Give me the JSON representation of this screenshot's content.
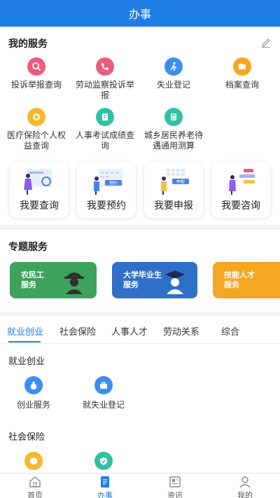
{
  "header": {
    "title": "办事"
  },
  "my_services": {
    "title": "我的服务",
    "items": [
      {
        "label": "投诉举报查询",
        "icon": "complaint-search-icon",
        "color": "#ef5a7a"
      },
      {
        "label": "劳动监察投诉举报",
        "icon": "phone-icon",
        "color": "#ef5a7a"
      },
      {
        "label": "失业登记",
        "icon": "walking-person-icon",
        "color": "#3a8ff0"
      },
      {
        "label": "档案查询",
        "icon": "archive-folder-icon",
        "color": "#f5a623"
      },
      {
        "label": "医疗保险个人权益查询",
        "icon": "medical-insurance-icon",
        "color": "#f5b82e"
      },
      {
        "label": "人事考试成绩查询",
        "icon": "exam-clipboard-icon",
        "color": "#2ec2a5"
      },
      {
        "label": "城乡居民养老待遇通用测算",
        "icon": "pension-calculator-icon",
        "color": "#2ec2a5"
      }
    ]
  },
  "quick_actions": [
    {
      "label": "我要查询"
    },
    {
      "label": "我要预约",
      "tag": "预约"
    },
    {
      "label": "我要申报",
      "tag": "申报"
    },
    {
      "label": "我要咨询"
    }
  ],
  "topics": {
    "title": "专题服务",
    "banners": [
      {
        "line1": "农民工",
        "line2": "服务",
        "color": "#3da25b"
      },
      {
        "line1": "大学毕业生",
        "line2": "服务",
        "color": "#2f6fc8"
      },
      {
        "line1": "技能人才",
        "line2": "服务",
        "color": "#f5a623"
      }
    ]
  },
  "tabs": [
    "就业创业",
    "社会保险",
    "人事人才",
    "劳动关系",
    "综合"
  ],
  "employment": {
    "title": "就业创业",
    "items": [
      {
        "label": "创业服务",
        "icon": "money-bag-icon",
        "color": "#3a8ff0"
      },
      {
        "label": "就失业登记",
        "icon": "briefcase-icon",
        "color": "#3a8ff0"
      }
    ]
  },
  "social_insurance": {
    "title": "社会保险",
    "items": [
      {
        "icon": "box-icon",
        "color": "#f5b82e"
      },
      {
        "icon": "shield-check-icon",
        "color": "#2ec2a5"
      }
    ]
  },
  "bottom_nav": [
    {
      "label": "首页",
      "icon": "home-icon"
    },
    {
      "label": "办事",
      "icon": "task-doc-icon"
    },
    {
      "label": "资讯",
      "icon": "newspaper-icon"
    },
    {
      "label": "我的",
      "icon": "person-icon"
    }
  ]
}
